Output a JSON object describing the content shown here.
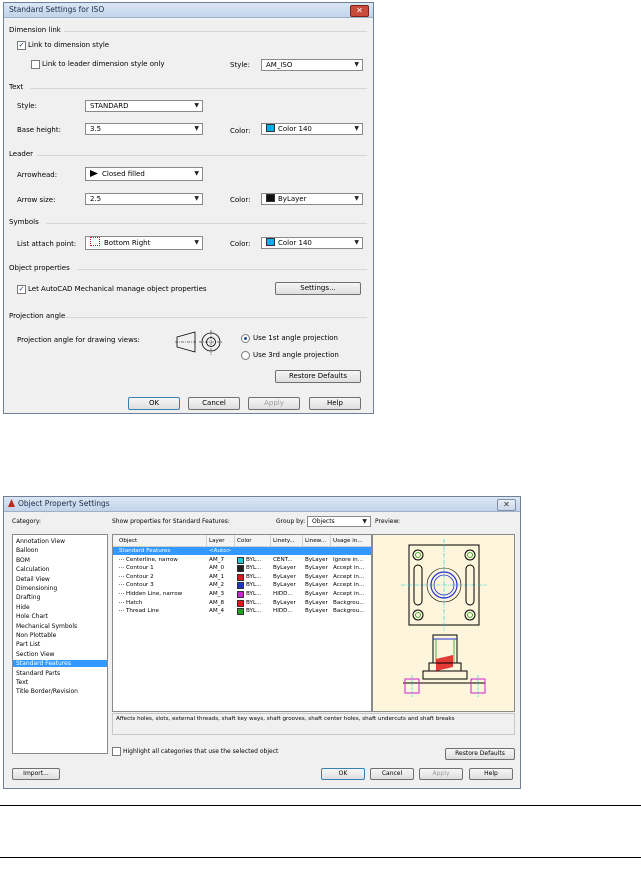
{
  "dialog1": {
    "title": "Standard Settings for ISO",
    "close_glyph": "✕",
    "dimension_link": {
      "heading": "Dimension link",
      "link_dimension_style": "Link to dimension style",
      "link_leader_style": "Link to leader dimension style only",
      "style_label": "Style:",
      "style_value": "AM_ISO"
    },
    "text": {
      "heading": "Text",
      "style_label": "Style:",
      "style_value": "STANDARD",
      "base_height_label": "Base height:",
      "base_height_value": "3.5",
      "color_label": "Color:",
      "color_value": "Color 140",
      "color_hex": "#00b0e8"
    },
    "leader": {
      "heading": "Leader",
      "arrowhead_label": "Arrowhead:",
      "arrowhead_value": "Closed filled",
      "arrow_size_label": "Arrow size:",
      "arrow_size_value": "2.5",
      "color_label": "Color:",
      "color_value": "ByLayer",
      "color_hex": "#111111"
    },
    "symbols": {
      "heading": "Symbols",
      "attach_label": "List attach point:",
      "attach_value": "Bottom Right",
      "color_label": "Color:",
      "color_value": "Color 140",
      "color_hex": "#00b0e8"
    },
    "object_properties": {
      "heading": "Object properties",
      "manage_label": "Let AutoCAD Mechanical manage object properties",
      "settings_button": "Settings..."
    },
    "projection": {
      "heading": "Projection angle",
      "label": "Projection angle for drawing views:",
      "first_angle": "Use 1st angle projection",
      "third_angle": "Use 3rd angle projection",
      "restore_button": "Restore Defaults"
    },
    "buttons": {
      "ok": "OK",
      "cancel": "Cancel",
      "apply": "Apply",
      "help": "Help"
    }
  },
  "dialog2": {
    "title": "Object Property Settings",
    "category_label": "Category:",
    "show_label": "Show properties for Standard Features:",
    "group_by_label": "Group by:",
    "group_by_value": "Objects",
    "preview_label": "Preview:",
    "categories": [
      "Annotation View",
      "Balloon",
      "BOM",
      "Calculation",
      "Detail View",
      "Dimensioning",
      "Drafting",
      "Hide",
      "Hole Chart",
      "Mechanical Symbols",
      "Non Plottable",
      "Part List",
      "Section View",
      "Standard Features",
      "Standard Parts",
      "Text",
      "Title Border/Revision"
    ],
    "selected_category": "Standard Features",
    "columns": [
      "Object",
      "Layer",
      "Color",
      "Linety...",
      "Linew...",
      "Usage in..."
    ],
    "rows": [
      {
        "object": "Standard Features",
        "layer": "<Auto>",
        "color": "",
        "linetype": "",
        "lineweight": "",
        "usage": "",
        "swatch": "",
        "group": true
      },
      {
        "object": "Centerline, narrow",
        "layer": "AM_7",
        "color": "BYL...",
        "linetype": "CENT...",
        "lineweight": "ByLayer",
        "usage": "Ignore in...",
        "swatch": "#1ac8d8"
      },
      {
        "object": "Contour 1",
        "layer": "AM_0",
        "color": "BYL...",
        "linetype": "ByLayer",
        "lineweight": "ByLayer",
        "usage": "Accept in...",
        "swatch": "#222222"
      },
      {
        "object": "Contour 2",
        "layer": "AM_1",
        "color": "BYL...",
        "linetype": "ByLayer",
        "lineweight": "ByLayer",
        "usage": "Accept in...",
        "swatch": "#e01818"
      },
      {
        "object": "Contour 3",
        "layer": "AM_2",
        "color": "BYL...",
        "linetype": "ByLayer",
        "lineweight": "ByLayer",
        "usage": "Accept in...",
        "swatch": "#2030d8"
      },
      {
        "object": "Hidden Line, narrow",
        "layer": "AM_3",
        "color": "BYL...",
        "linetype": "HIDD...",
        "lineweight": "ByLayer",
        "usage": "Accept in...",
        "swatch": "#d020d0"
      },
      {
        "object": "Hatch",
        "layer": "AM_8",
        "color": "BYL...",
        "linetype": "ByLayer",
        "lineweight": "ByLayer",
        "usage": "Backgrou...",
        "swatch": "#e01818"
      },
      {
        "object": "Thread Line",
        "layer": "AM_4",
        "color": "BYL...",
        "linetype": "HIDD...",
        "lineweight": "ByLayer",
        "usage": "Backgrou...",
        "swatch": "#20a020"
      }
    ],
    "description": "Affects holes, slots, external threads, shaft key ways, shaft grooves, shaft center holes, shaft undercuts and shaft breaks",
    "highlight_label": "Highlight all categories that use the selected object",
    "restore_button": "Restore Defaults",
    "buttons": {
      "import": "Import...",
      "ok": "OK",
      "cancel": "Cancel",
      "apply": "Apply",
      "help": "Help"
    }
  }
}
